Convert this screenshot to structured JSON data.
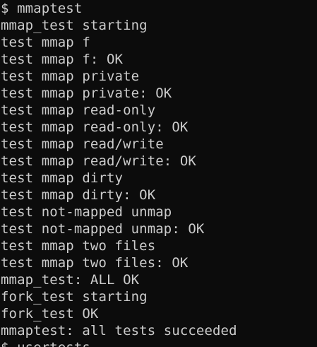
{
  "terminal": {
    "colors": {
      "background": "#0c0c0c",
      "foreground": "#cccccc"
    },
    "lines": [
      "$ mmaptest",
      "mmap_test starting",
      "test mmap f",
      "test mmap f: OK",
      "test mmap private",
      "test mmap private: OK",
      "test mmap read-only",
      "test mmap read-only: OK",
      "test mmap read/write",
      "test mmap read/write: OK",
      "test mmap dirty",
      "test mmap dirty: OK",
      "test not-mapped unmap",
      "test not-mapped unmap: OK",
      "test mmap two files",
      "test mmap two files: OK",
      "mmap_test: ALL OK",
      "fork_test starting",
      "fork_test OK",
      "mmaptest: all tests succeeded",
      "$ usertests"
    ]
  }
}
